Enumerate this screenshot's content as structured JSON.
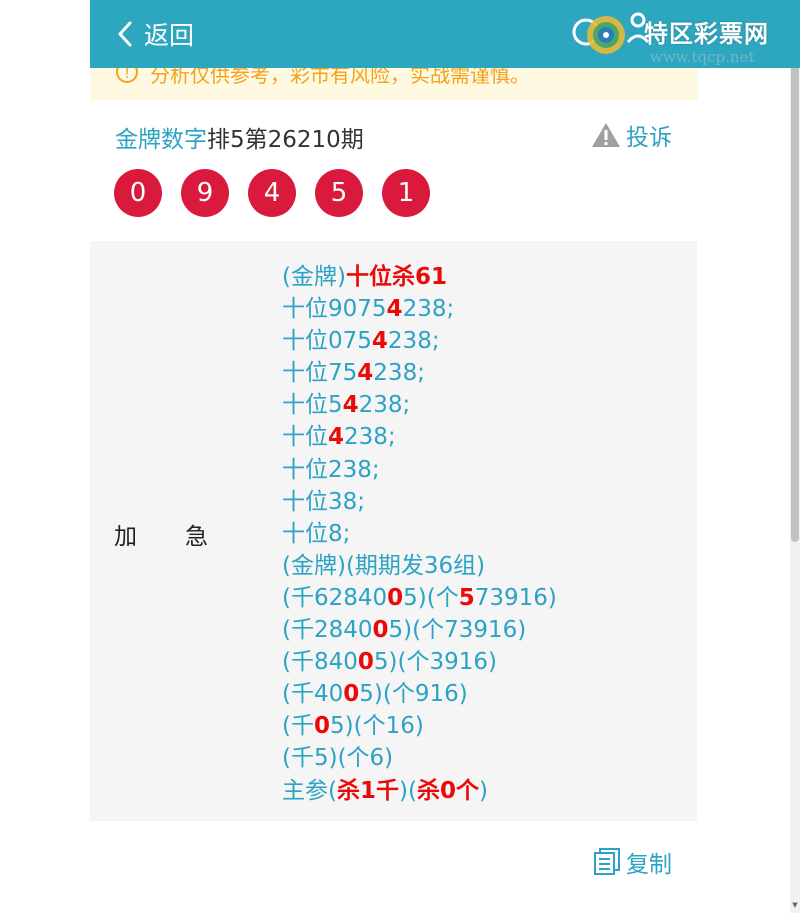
{
  "header": {
    "back_label": "返回",
    "watermark_brand": "特区彩票网",
    "watermark_url": "www.tqcp.net"
  },
  "notice": {
    "text": "分析仅供参考，彩市有风险，实战需谨慎。"
  },
  "title": {
    "highlight": "金牌数字",
    "rest": "排5第26210期",
    "complain_label": "投诉"
  },
  "balls": [
    "0",
    "9",
    "4",
    "5",
    "1"
  ],
  "panel": {
    "label_a": "加",
    "label_b": "急",
    "lines": [
      [
        {
          "t": "(金牌)"
        },
        {
          "t": "十位杀61",
          "r": true
        }
      ],
      [
        {
          "t": "十位9075"
        },
        {
          "t": "4",
          "r": true
        },
        {
          "t": "238;"
        }
      ],
      [
        {
          "t": "十位075"
        },
        {
          "t": "4",
          "r": true
        },
        {
          "t": "238;"
        }
      ],
      [
        {
          "t": "十位75"
        },
        {
          "t": "4",
          "r": true
        },
        {
          "t": "238;"
        }
      ],
      [
        {
          "t": "十位5"
        },
        {
          "t": "4",
          "r": true
        },
        {
          "t": "238;"
        }
      ],
      [
        {
          "t": "十位"
        },
        {
          "t": "4",
          "r": true
        },
        {
          "t": "238;"
        }
      ],
      [
        {
          "t": "十位238;"
        }
      ],
      [
        {
          "t": "十位38;"
        }
      ],
      [
        {
          "t": "十位8;"
        }
      ],
      [
        {
          "t": "(金牌)(期期发36组)"
        }
      ],
      [
        {
          "t": "(千62840"
        },
        {
          "t": "0",
          "r": true
        },
        {
          "t": "5)(个"
        },
        {
          "t": "5",
          "r": true
        },
        {
          "t": "73916)"
        }
      ],
      [
        {
          "t": "(千2840"
        },
        {
          "t": "0",
          "r": true
        },
        {
          "t": "5)(个73916)"
        }
      ],
      [
        {
          "t": "(千840"
        },
        {
          "t": "0",
          "r": true
        },
        {
          "t": "5)(个3916)"
        }
      ],
      [
        {
          "t": "(千40"
        },
        {
          "t": "0",
          "r": true
        },
        {
          "t": "5)(个916)"
        }
      ],
      [
        {
          "t": "(千"
        },
        {
          "t": "0",
          "r": true
        },
        {
          "t": "5)(个16)"
        }
      ],
      [
        {
          "t": "(千5)(个6)"
        }
      ],
      [
        {
          "t": "主参("
        },
        {
          "t": "杀1千",
          "r": true
        },
        {
          "t": ")("
        },
        {
          "t": "杀0个",
          "r": true
        },
        {
          "t": ")"
        }
      ]
    ]
  },
  "footer": {
    "copy_label": "复制"
  },
  "colors": {
    "header_bg": "#2da7bf",
    "accent_text": "#2ca3c4",
    "ball_red": "#d91a3c",
    "notice_bg": "#fff9e1",
    "notice_text": "#f3a21b",
    "emphasis_red": "#ea0a0a"
  },
  "icons": {
    "back": "chevron-left-icon",
    "notice": "info-circle-icon",
    "complain": "warning-triangle-icon",
    "copy": "copy-document-icon"
  }
}
